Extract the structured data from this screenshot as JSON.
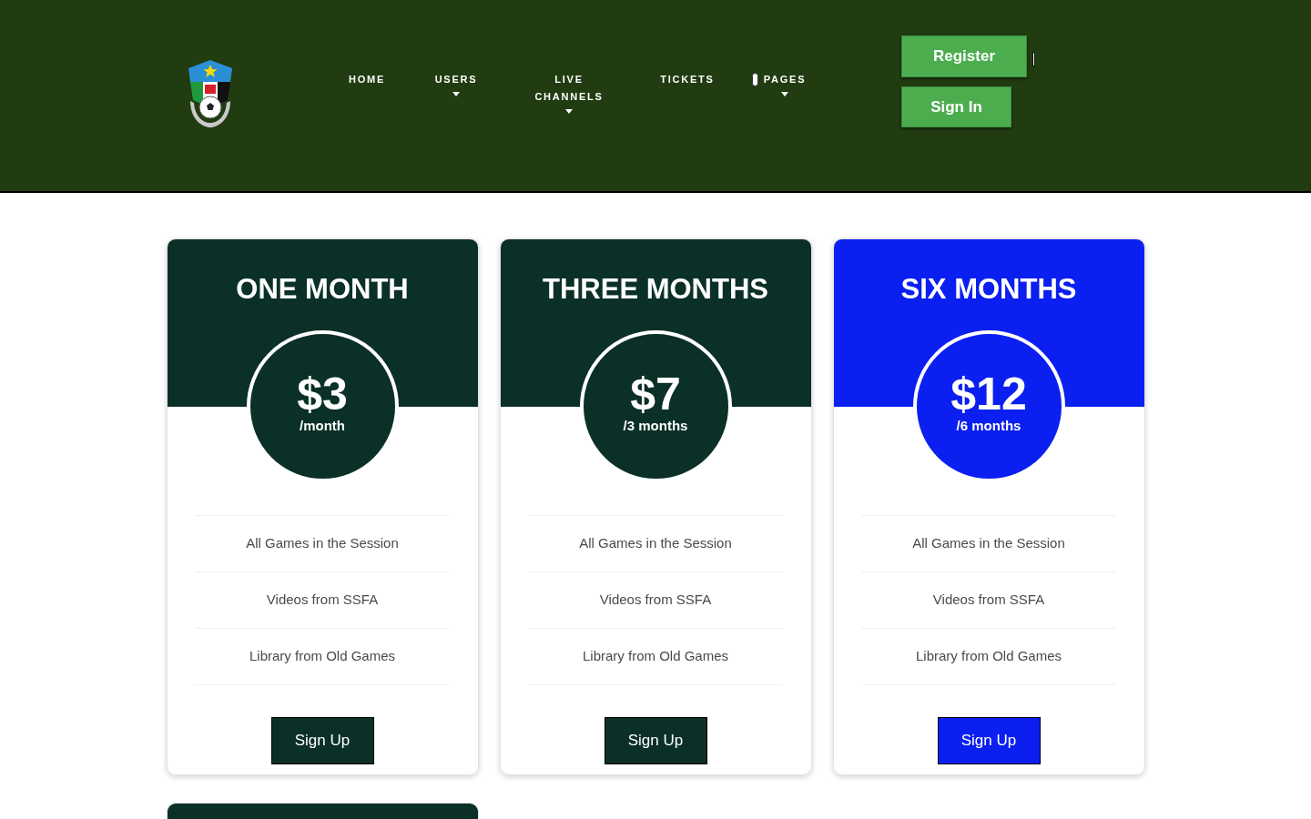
{
  "header": {
    "nav": [
      {
        "label": "HOME",
        "dropdown": false
      },
      {
        "label": "USERS",
        "dropdown": true
      },
      {
        "label": "LIVE CHANNELS",
        "dropdown": true
      },
      {
        "label": "TICKETS",
        "dropdown": false
      },
      {
        "label": "PAGES",
        "dropdown": true
      }
    ],
    "buttons": [
      "Register",
      "Sign In"
    ]
  },
  "plans": [
    {
      "kind": "full",
      "title": "ONE MONTH",
      "price": "$3",
      "period": "/month",
      "color": "#0b3027",
      "features": [
        "All Games in the Session",
        "Videos from SSFA",
        "Library from Old Games"
      ],
      "button": "Sign Up"
    },
    {
      "kind": "full",
      "title": "THREE MONTHS",
      "price": "$7",
      "period": "/3 months",
      "color": "#0b3027",
      "features": [
        "All Games in the Session",
        "Videos from SSFA",
        "Library from Old Games"
      ],
      "button": "Sign Up"
    },
    {
      "kind": "full",
      "title": "SIX MONTHS",
      "price": "$12",
      "period": "/6 months",
      "color": "#0b1ff0",
      "features": [
        "All Games in the Session",
        "Videos from SSFA",
        "Library from Old Games"
      ],
      "button": "Sign Up"
    },
    {
      "kind": "cut_off",
      "color": "#0b3027"
    }
  ]
}
